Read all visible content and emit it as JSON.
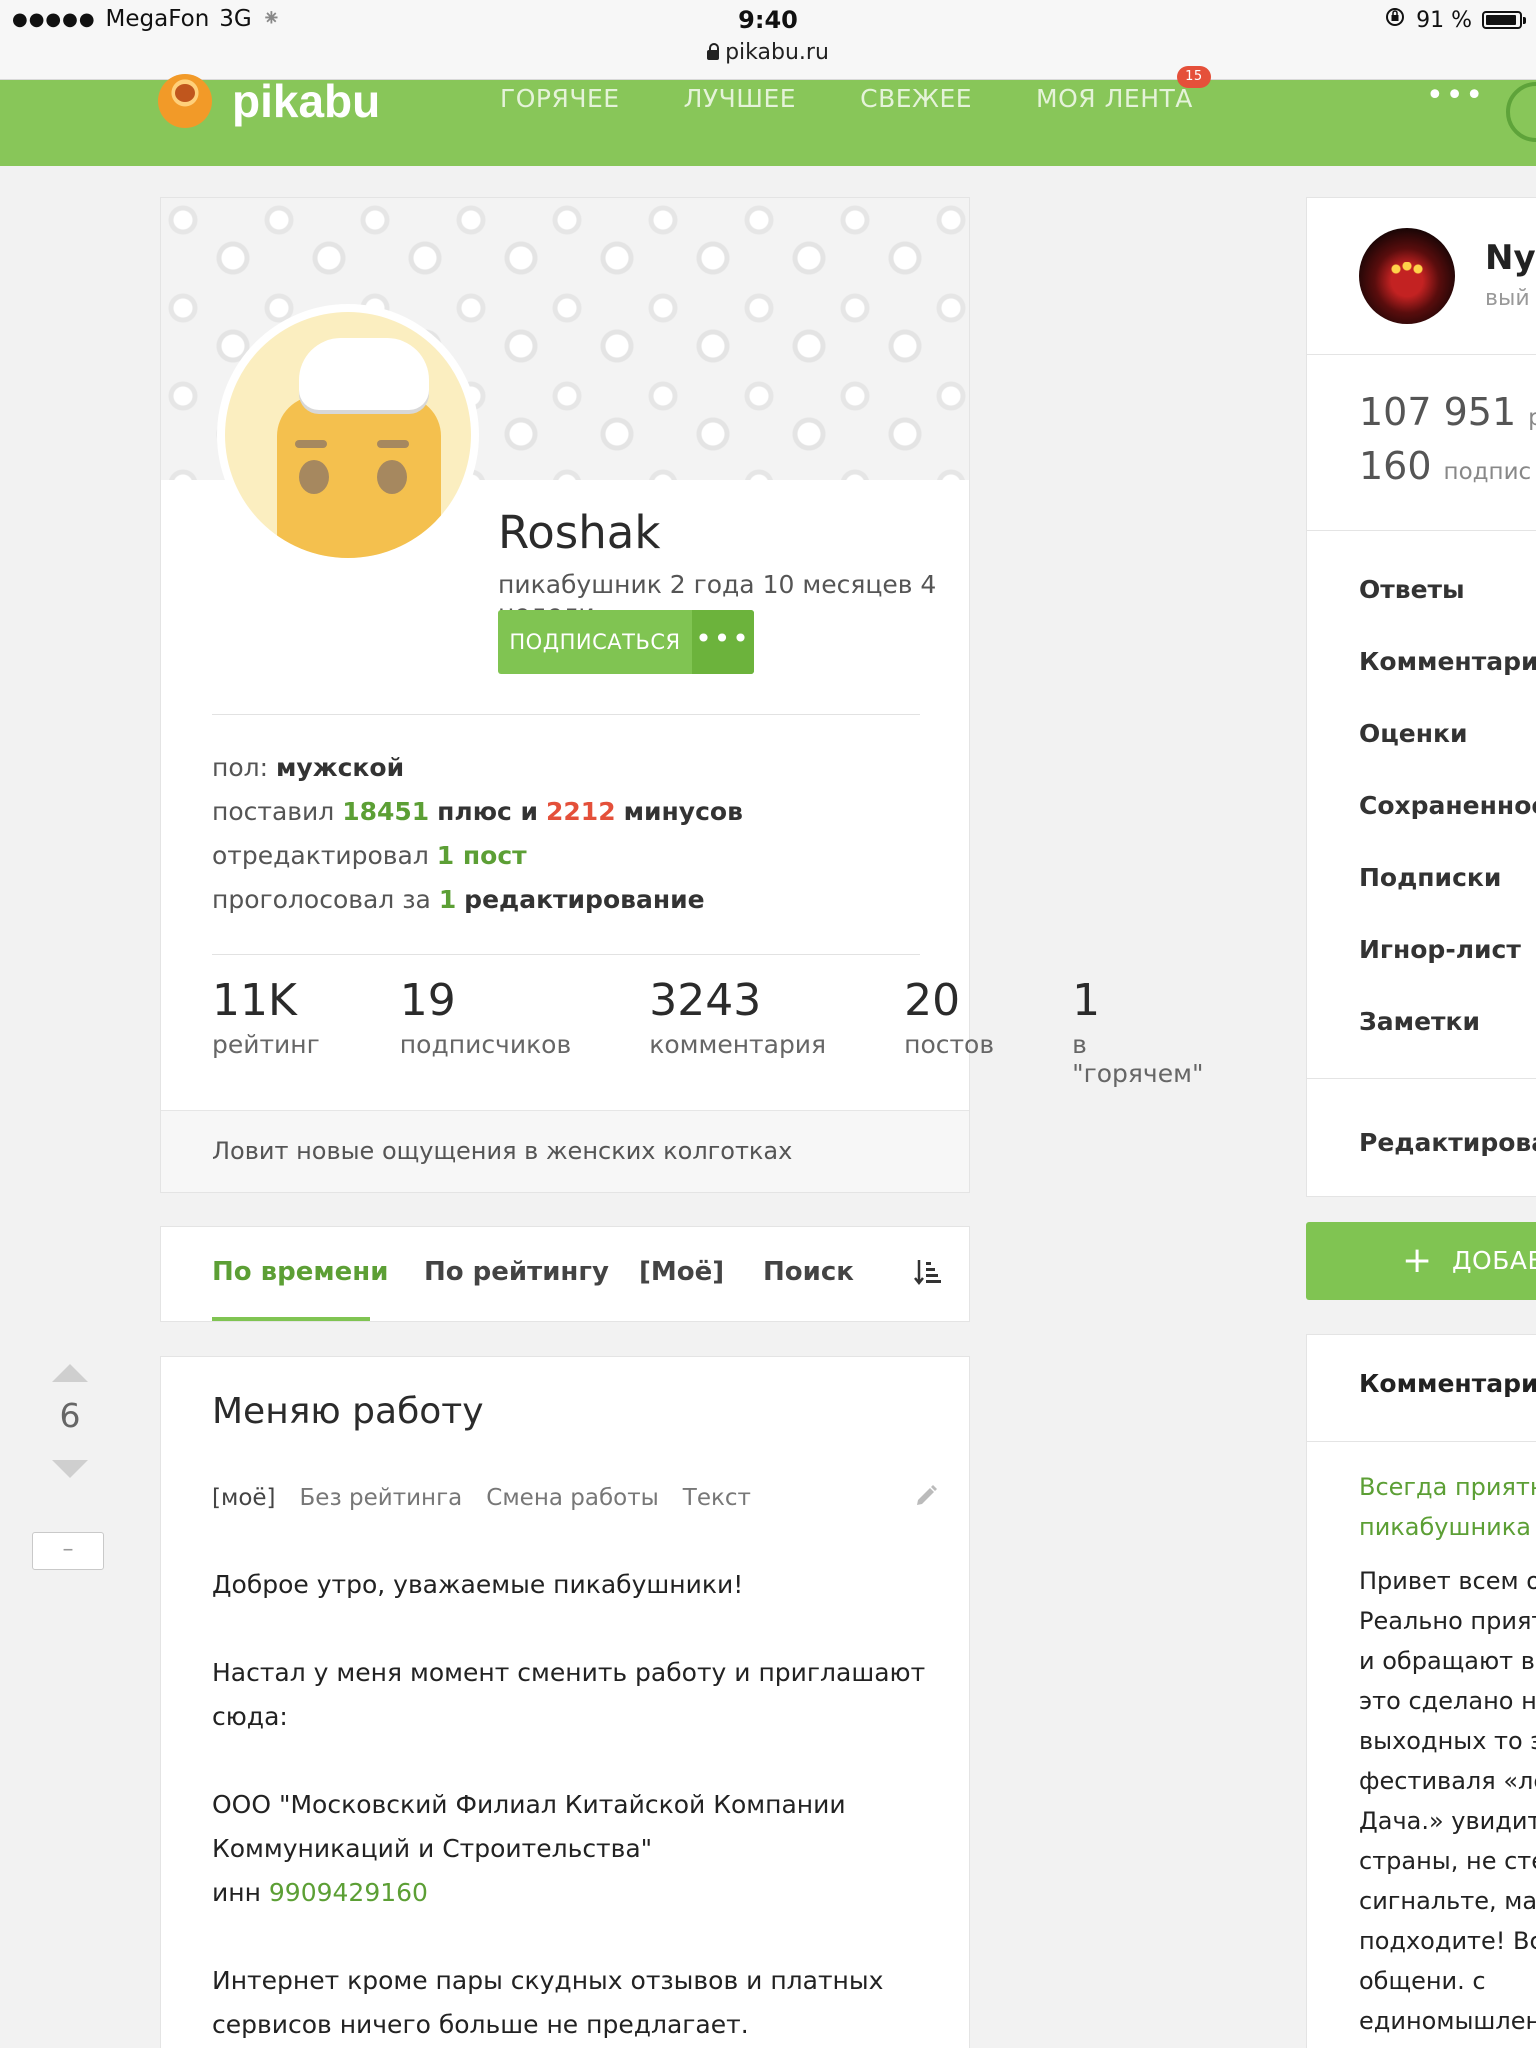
{
  "status_bar": {
    "signal": "●●●●●",
    "carrier": "MegaFon",
    "network": "3G",
    "activity": "⁕",
    "time": "9:40",
    "battery": "91 %",
    "url": "pikabu.ru"
  },
  "header": {
    "logo_text": "pikabu",
    "nav": [
      "ГОРЯЧЕЕ",
      "ЛУЧШЕЕ",
      "СВЕЖЕЕ",
      "МОЯ ЛЕНТА"
    ],
    "feed_badge": "15",
    "more": "•••"
  },
  "profile": {
    "name": "Roshak",
    "since": "пикабушник 2 года 10 месяцев 4 недели",
    "subscribe_label": "ПОДПИСАТЬСЯ",
    "more_label": "•••",
    "gender_label": "пол:",
    "gender_value": "мужской",
    "votes_prefix": "поставил",
    "plus_count": "18451",
    "plus_text": "плюс и",
    "minus_count": "2212",
    "minus_text": "минусов",
    "edited_prefix": "отредактировал",
    "edited_value": "1 пост",
    "voted_prefix": "проголосовал за",
    "voted_count": "1",
    "voted_text": "редактирование",
    "stats": [
      {
        "value": "11K",
        "label": "рейтинг"
      },
      {
        "value": "19",
        "label": "подписчиков"
      },
      {
        "value": "3243",
        "label": "комментария"
      },
      {
        "value": "20",
        "label": "постов"
      },
      {
        "value": "1",
        "label": "в \"горячем\""
      }
    ],
    "about": "Ловит новые ощущения в женских колготках"
  },
  "tabs": {
    "items": [
      "По времени",
      "По рейтингу",
      "[Моё]",
      "Поиск"
    ],
    "active": "По времени"
  },
  "post": {
    "rating": "6",
    "collapse_label": "–",
    "title": "Меняю работу",
    "tags": [
      "[моё]",
      "Без рейтинга",
      "Смена работы",
      "Текст"
    ],
    "body_1": "Доброе утро, уважаемые пикабушники!",
    "body_2": "Настал у меня момент сменить работу и приглашают сюда:",
    "body_3": "ООО \"Московский Филиал Китайской Компании Коммуникаций и Строительства\"",
    "inn_label": "инн",
    "inn_value": "9909429160",
    "body_4": "Интернет кроме пары скудных отзывов и платных сервисов ничего больше не предлагает."
  },
  "sidebar": {
    "user_name": "Nya",
    "user_sub": "вый",
    "rating_value": "107 951",
    "rating_label": "р",
    "subs_value": "160",
    "subs_label": "подпис",
    "menu": [
      "Ответы",
      "Комментарии",
      "Оценки",
      "Сохраненное",
      "Подписки",
      "Игнор-лист",
      "Заметки"
    ],
    "edit_label": "Редактирова",
    "add_label": "ДОБАВ",
    "comments_header": "Комментарий",
    "comment_link_1": "Всегда приятно",
    "comment_link_2": "пикабушника і",
    "comment_lines": [
      "Привет всем о",
      "Реально прият",
      "и обращают вн",
      "это сделано на",
      "выходных то э",
      "фестиваля «лё",
      "Дача.» увидите",
      "страны, не сте",
      "сигнальте, маш",
      "подходите! Все",
      "общени. с",
      "единомышлен"
    ]
  },
  "colors": {
    "brand_green": "#88c659",
    "button_green": "#80c452",
    "link_green": "#5c9f35",
    "minus_red": "#e4503a",
    "badge_red": "#e5503a"
  },
  "icons": [
    "lock-icon",
    "battery-icon",
    "pikabu-logo-icon",
    "more-dots-icon",
    "sort-icon",
    "edit-pencil-icon",
    "vote-up-icon",
    "vote-down-icon",
    "plus-icon"
  ]
}
